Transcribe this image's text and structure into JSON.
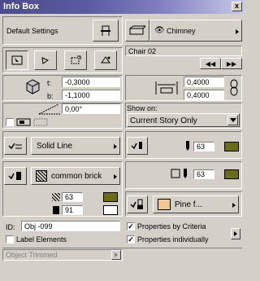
{
  "window": {
    "title": "Info Box",
    "close": "x"
  },
  "settings": {
    "default_label": "Default Settings",
    "view_label": "Chimney"
  },
  "element": {
    "name": "Chair 02"
  },
  "elevation": {
    "top_label": "t:",
    "top_value": "-0,3000",
    "bottom_label": "b:",
    "bottom_value": "-1,1000"
  },
  "size": {
    "width": "0,4000",
    "depth": "0,4000"
  },
  "angle": {
    "value": "0,00°"
  },
  "show_on": {
    "label": "Show on:",
    "value": "Current Story Only"
  },
  "line": {
    "type": "Solid Line",
    "pen": "63"
  },
  "fill": {
    "name": "common brick",
    "pen": "63"
  },
  "pens": {
    "fill_pen": "63",
    "bg_pen": "91"
  },
  "material": {
    "name": "Pine f..."
  },
  "id": {
    "label": "ID:",
    "value": "Obj -099"
  },
  "options": {
    "label_elements": "Label Elements",
    "props_by_criteria": "Properties by Criteria",
    "props_individually": "Properties individually",
    "props_by_criteria_checked": "✓",
    "props_individually_checked": "✓"
  },
  "status": {
    "text": "Object Trimmed"
  },
  "colors": {
    "pen_olive": "#6b6b1e",
    "material_wood": "#f0c890"
  }
}
